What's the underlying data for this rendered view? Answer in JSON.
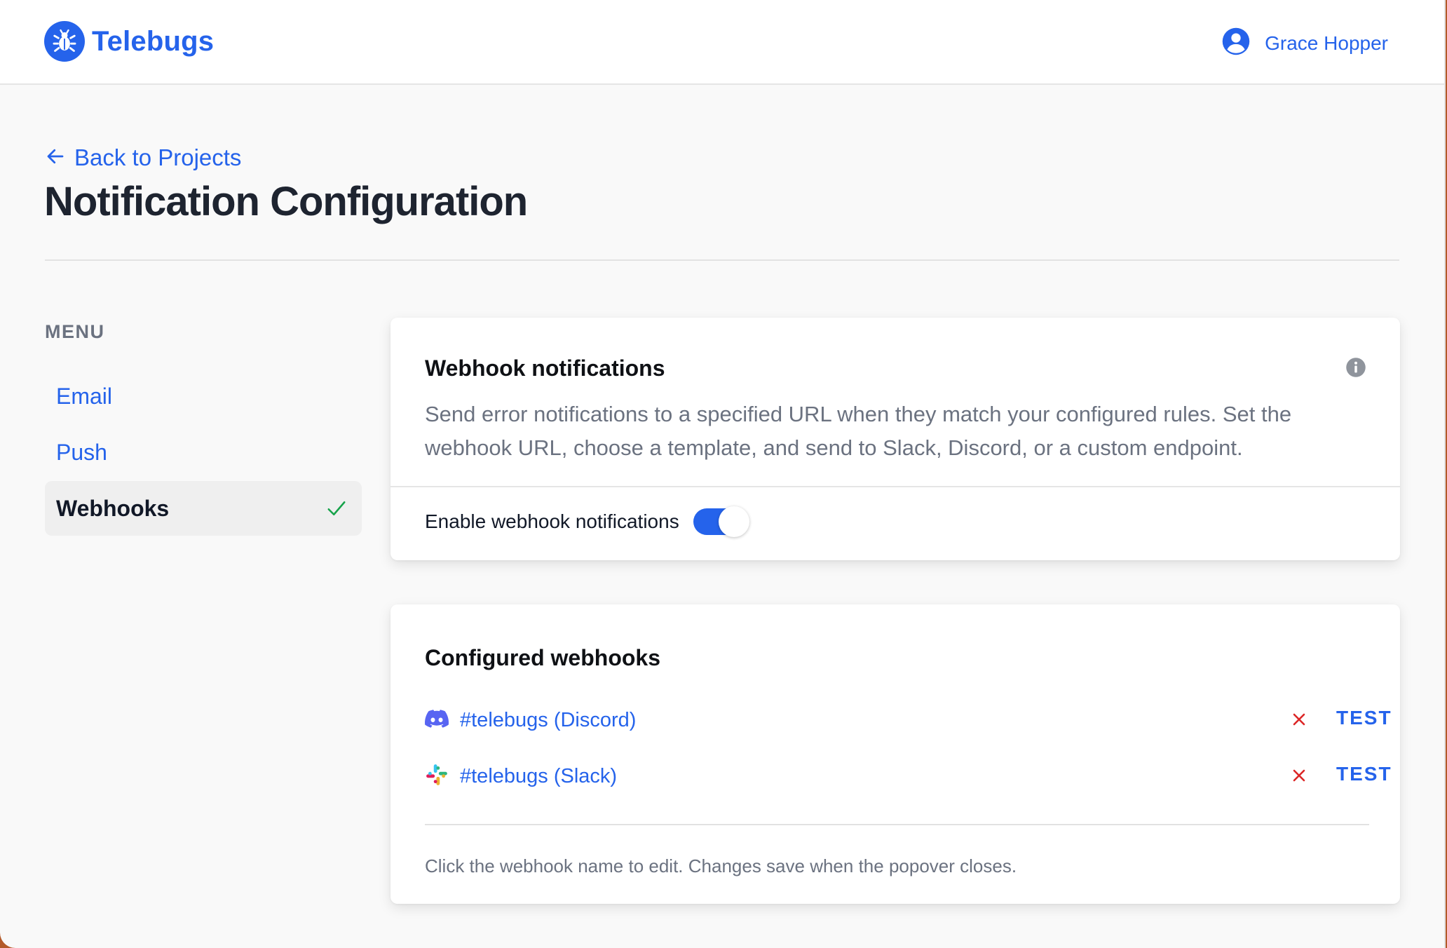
{
  "app": {
    "name": "Telebugs",
    "brand_color": "#2563eb",
    "logo_icon": "bug-icon"
  },
  "user": {
    "name": "Grace Hopper",
    "icon": "user-circle-icon"
  },
  "nav": {
    "back_label": "Back to Projects",
    "back_icon": "arrow-left-icon"
  },
  "page": {
    "title": "Notification Configuration"
  },
  "sidebar": {
    "heading": "MENU",
    "items": [
      {
        "label": "Email",
        "active": false
      },
      {
        "label": "Push",
        "active": false
      },
      {
        "label": "Webhooks",
        "active": true,
        "icon": "check-icon"
      }
    ]
  },
  "webhook_card": {
    "title": "Webhook notifications",
    "description": "Send error notifications to a specified URL when they match your configured rules. Set the webhook URL, choose a template, and send to Slack, Discord, or a custom endpoint.",
    "toggle_label": "Enable webhook notifications",
    "toggle_on": true,
    "info_icon": "info-icon"
  },
  "configured": {
    "title": "Configured webhooks",
    "webhooks": [
      {
        "name": "#telebugs (Discord)",
        "icon": "discord-icon",
        "test_label": "TEST"
      },
      {
        "name": "#telebugs (Slack)",
        "icon": "slack-icon",
        "test_label": "TEST"
      }
    ],
    "hint": "Click the webhook name to edit. Changes save when the popover closes."
  },
  "colors": {
    "accent": "#2563eb",
    "danger": "#dc2626",
    "success": "#16a34a"
  }
}
